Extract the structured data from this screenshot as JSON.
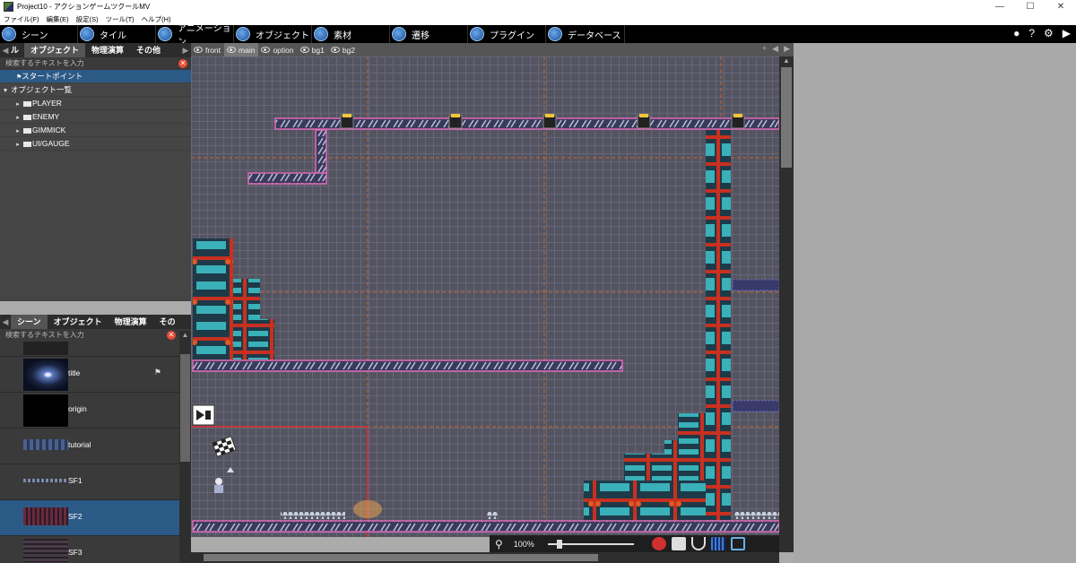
{
  "window": {
    "title": "Project10 - アクションゲームツクールMV",
    "minimize": "—",
    "maximize": "☐",
    "close": "✕"
  },
  "menu": [
    "ファイル(F)",
    "編集(E)",
    "設定(S)",
    "ツール(T)",
    "ヘルプ(H)"
  ],
  "toolbar": {
    "buttons": [
      "シーン",
      "タイル",
      "アニメーション",
      "オブジェクト",
      "素材",
      "遷移",
      "プラグイン",
      "データベース"
    ],
    "right_icons": [
      "●",
      "?",
      "⚙",
      "▶"
    ]
  },
  "object_panel": {
    "tabs": [
      "ル",
      "オブジェクト",
      "物理演算",
      "その他"
    ],
    "search_placeholder": "検索するテキストを入力",
    "clear": "✕",
    "start_point": "スタートポイント",
    "list_header": "オブジェクト一覧",
    "folders": [
      "PLAYER",
      "ENEMY",
      "GIMMICK",
      "UI/GAUGE"
    ]
  },
  "scene_panel": {
    "tabs": [
      "シーン",
      "オブジェクト",
      "物理演算",
      "その"
    ],
    "search_placeholder": "検索するテキストを入力",
    "clear": "✕",
    "scenes": [
      {
        "label": "",
        "thumb": "#222"
      },
      {
        "label": "title",
        "thumb": "#1a2a4a"
      },
      {
        "label": "origin",
        "thumb": "#000000"
      },
      {
        "label": "tutorial",
        "thumb": "#3a4a6a"
      },
      {
        "label": "SF1",
        "thumb": "#333"
      },
      {
        "label": "SF2",
        "thumb": "#3a1e2a"
      },
      {
        "label": "SF3",
        "thumb": "#2a2a3a"
      }
    ]
  },
  "layers": {
    "tabs": [
      "front",
      "main",
      "option",
      "bg1",
      "bg2"
    ],
    "active": "main"
  },
  "canvas": {
    "zoom": "100%"
  },
  "colors": {
    "accent": "#2c5a86",
    "platform_border": "#e06ab8",
    "tile_teal": "#3ab0b8",
    "tile_border": "#d23c28",
    "guide_orange": "#d86a20"
  }
}
